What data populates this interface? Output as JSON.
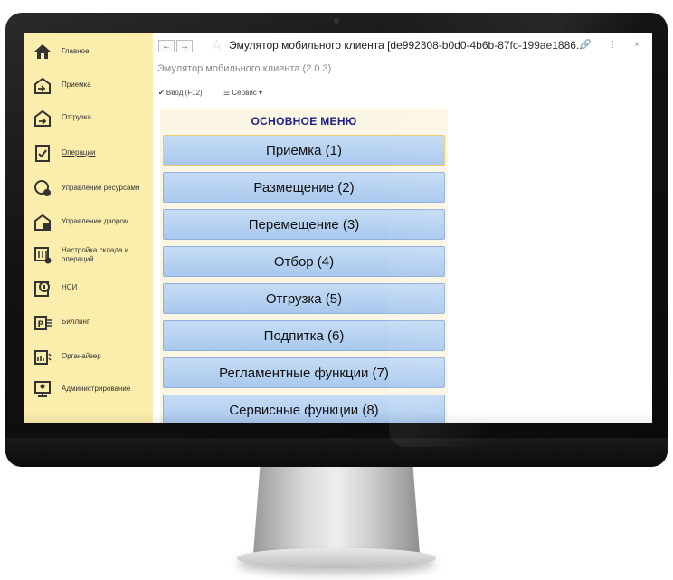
{
  "window": {
    "back_label": "←",
    "forward_label": "→",
    "star": "☆",
    "title": "Эмулятор мобильного клиента [de992308-b0d0-4b6b-87fc-199ae1886...",
    "toolbar_icons": "🔗 ⋮ ×"
  },
  "subtitle": "Эмулятор мобильного клиента (2.0.3)",
  "commands": {
    "enter_label": "✔ Ввод (F12)",
    "service_label": "☰ Сервис ▾"
  },
  "sidebar": {
    "items": [
      {
        "label": "Главное",
        "icon": "home-icon"
      },
      {
        "label": "Приемка",
        "icon": "receipt-icon"
      },
      {
        "label": "Отгрузка",
        "icon": "shipment-icon"
      },
      {
        "label": "Операции",
        "icon": "operations-icon"
      },
      {
        "label": "Управление ресурсами",
        "icon": "resources-icon"
      },
      {
        "label": "Управление двором",
        "icon": "yard-icon"
      },
      {
        "label": "Настройка склада и операций",
        "icon": "warehouse-settings-icon"
      },
      {
        "label": "НСИ",
        "icon": "reference-data-icon"
      },
      {
        "label": "Биллинг",
        "icon": "billing-icon"
      },
      {
        "label": "Органайзер",
        "icon": "organizer-icon"
      },
      {
        "label": "Администрирование",
        "icon": "admin-icon"
      }
    ],
    "active_index": 3
  },
  "menu": {
    "header": "ОСНОВНОЕ МЕНЮ",
    "buttons": [
      "Приемка (1)",
      "Размещение (2)",
      "Перемещение (3)",
      "Отбор (4)",
      "Отгрузка (5)",
      "Подпитка (6)",
      "Регламентные функции (7)",
      "Сервисные функции (8)"
    ]
  },
  "colors": {
    "sidebar_bg": "#fbeeac",
    "button_bg": "#b3cff0",
    "header_text": "#1d1d8c"
  }
}
